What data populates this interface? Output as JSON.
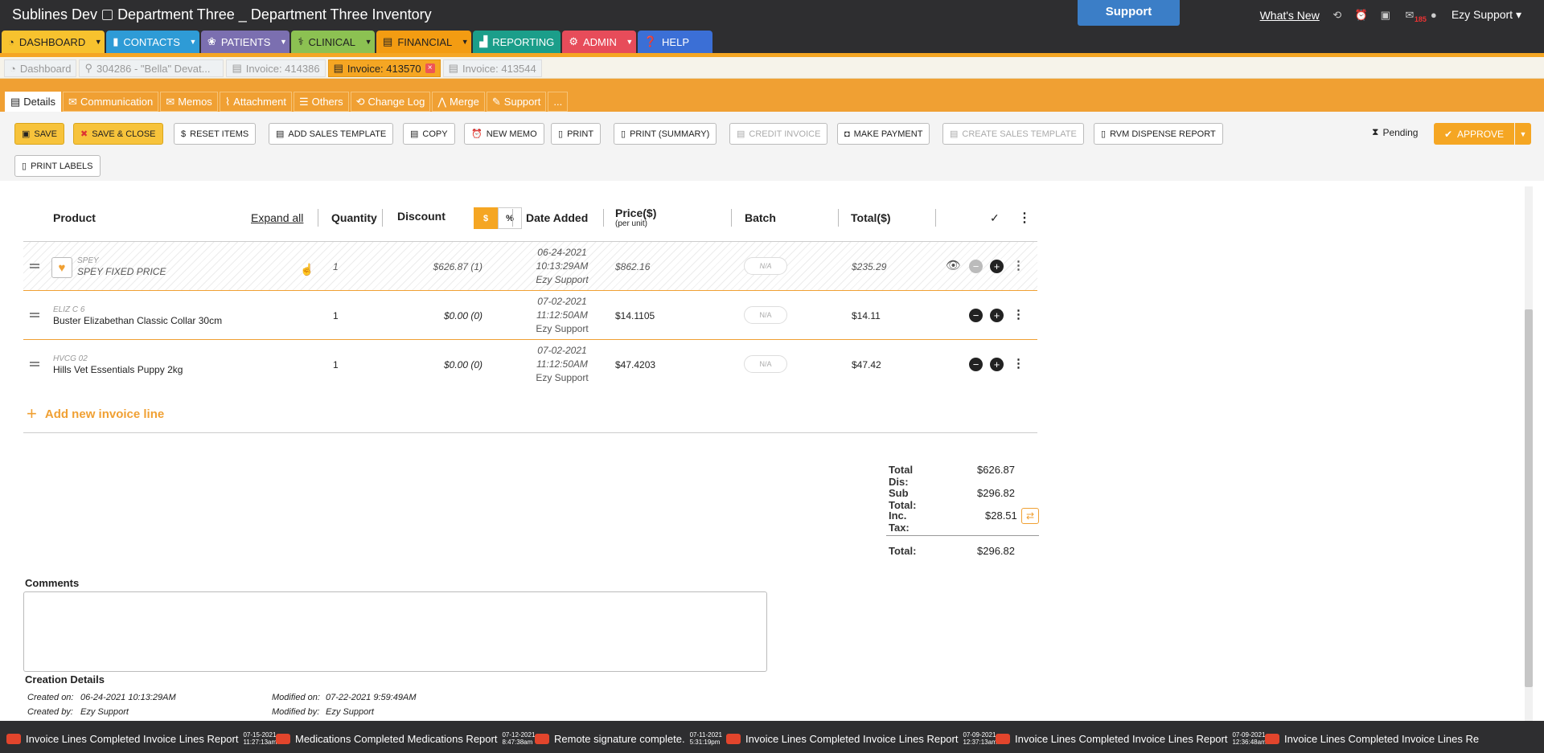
{
  "app": {
    "title": "Sublines Dev",
    "location": "Department Three _ Department Three Inventory",
    "support": "Support"
  },
  "header": {
    "whats_new": "What's New",
    "mail_count": "185",
    "user": "Ezy Support ▾"
  },
  "nav": {
    "dashboard": "DASHBOARD",
    "contacts": "CONTACTS",
    "patients": "PATIENTS",
    "clinical": "CLINICAL",
    "financial": "FINANCIAL",
    "reporting": "REPORTING",
    "admin": "ADMIN",
    "help": "HELP"
  },
  "subtabs": [
    "Dashboard",
    "304286 - \"Bella\" Devat...",
    "Invoice: 414386",
    "Invoice: 413570",
    "Invoice: 413544"
  ],
  "dtabs": [
    "Details",
    "Communication",
    "Memos",
    "Attachment",
    "Others",
    "Change Log",
    "Merge",
    "Support",
    "..."
  ],
  "toolbar": {
    "save": "SAVE",
    "save_close": "SAVE & CLOSE",
    "reset": "RESET ITEMS",
    "add_template": "ADD SALES TEMPLATE",
    "copy": "COPY",
    "new_memo": "NEW MEMO",
    "print": "PRINT",
    "print_summary": "PRINT (SUMMARY)",
    "credit": "CREDIT INVOICE",
    "payment": "MAKE PAYMENT",
    "create_template": "CREATE SALES TEMPLATE",
    "rvm": "RVM DISPENSE REPORT",
    "labels": "PRINT LABELS",
    "status": "Pending",
    "approve": "APPROVE"
  },
  "table": {
    "headers": {
      "product": "Product",
      "expand": "Expand all",
      "qty": "Quantity",
      "discount": "Discount",
      "disc_dollar": "$",
      "disc_pct": "%",
      "date": "Date Added",
      "price": "Price($)",
      "per_unit": "(per unit)",
      "batch": "Batch",
      "total": "Total($)"
    },
    "rows": [
      {
        "code": "SPEY",
        "name": "SPEY FIXED PRICE",
        "qty": "1",
        "discount": "$626.87 (1)",
        "date": "06-24-2021",
        "time": "10:13:29AM",
        "by": "Ezy Support",
        "price": "$862.16",
        "batch": "N/A",
        "total": "$235.29"
      },
      {
        "code": "ELIZ C 6",
        "name": "Buster Elizabethan Classic Collar 30cm",
        "qty": "1",
        "discount": "$0.00 (0)",
        "date": "07-02-2021",
        "time": "11:12:50AM",
        "by": "Ezy Support",
        "price": "$14.1105",
        "batch": "N/A",
        "total": "$14.11"
      },
      {
        "code": "HVCG 02",
        "name": "Hills Vet Essentials Puppy 2kg",
        "qty": "1",
        "discount": "$0.00 (0)",
        "date": "07-02-2021",
        "time": "11:12:50AM",
        "by": "Ezy Support",
        "price": "$47.4203",
        "batch": "N/A",
        "total": "$47.42"
      }
    ],
    "add_line": "Add new invoice line"
  },
  "totals": {
    "dis_l": "Total Dis:",
    "dis": "$626.87",
    "sub_l": "Sub Total:",
    "sub": "$296.82",
    "tax_l": "Inc. Tax:",
    "tax": "$28.51",
    "total_l": "Total:",
    "total": "$296.82"
  },
  "comments": {
    "label": "Comments"
  },
  "creation": {
    "label": "Creation Details",
    "created_on_l": "Created on:",
    "created_on": "06-24-2021 10:13:29AM",
    "created_by_l": "Created by:",
    "created_by": "Ezy Support",
    "modified_on_l": "Modified on:",
    "modified_on": "07-22-2021 9:59:49AM",
    "modified_by_l": "Modified by:",
    "modified_by": "Ezy Support"
  },
  "notifications": [
    {
      "text": "Invoice Lines Completed Invoice Lines Report",
      "date": "07-15-2021",
      "time": "11:27:13am"
    },
    {
      "text": "Medications Completed Medications Report",
      "date": "07-12-2021",
      "time": "8:47:38am"
    },
    {
      "text": "Remote signature complete.",
      "date": "07-11-2021",
      "time": "5:31:19pm"
    },
    {
      "text": "Invoice Lines Completed Invoice Lines Report",
      "date": "07-09-2021",
      "time": "12:37:13am"
    },
    {
      "text": "Invoice Lines Completed Invoice Lines Report",
      "date": "07-09-2021",
      "time": "12:36:48am"
    },
    {
      "text": "Invoice Lines Completed Invoice Lines Re",
      "date": "",
      "time": ""
    }
  ],
  "colors": {
    "accent": "#f5a623",
    "dark": "#2e2e30",
    "dashboard": "#f7c22e",
    "contacts": "#2e9bd6",
    "patients": "#7b6fb0",
    "clinical": "#8cc152",
    "financial": "#f39c12",
    "reporting": "#1b9e8a",
    "admin": "#e74c5a",
    "help": "#3b6fd6"
  }
}
